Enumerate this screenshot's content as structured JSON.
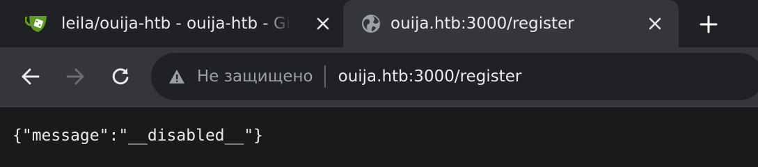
{
  "tabs": [
    {
      "title": "leila/ouija-htb - ouija-htb - Gitea: Git with a cup of tea",
      "icon": "gitea-icon",
      "active": false
    },
    {
      "title": "ouija.htb:3000/register",
      "icon": "globe-icon",
      "active": true
    }
  ],
  "omnibox": {
    "security_status": "Не защищено",
    "url": "ouija.htb:3000/register"
  },
  "page": {
    "body_text": "{\"message\":\"__disabled__\"}"
  },
  "colors": {
    "tabstrip": "#202124",
    "toolbar": "#35363a",
    "text": "#e8eaed",
    "muted": "#9aa0a6",
    "gitea_green": "#609926"
  }
}
